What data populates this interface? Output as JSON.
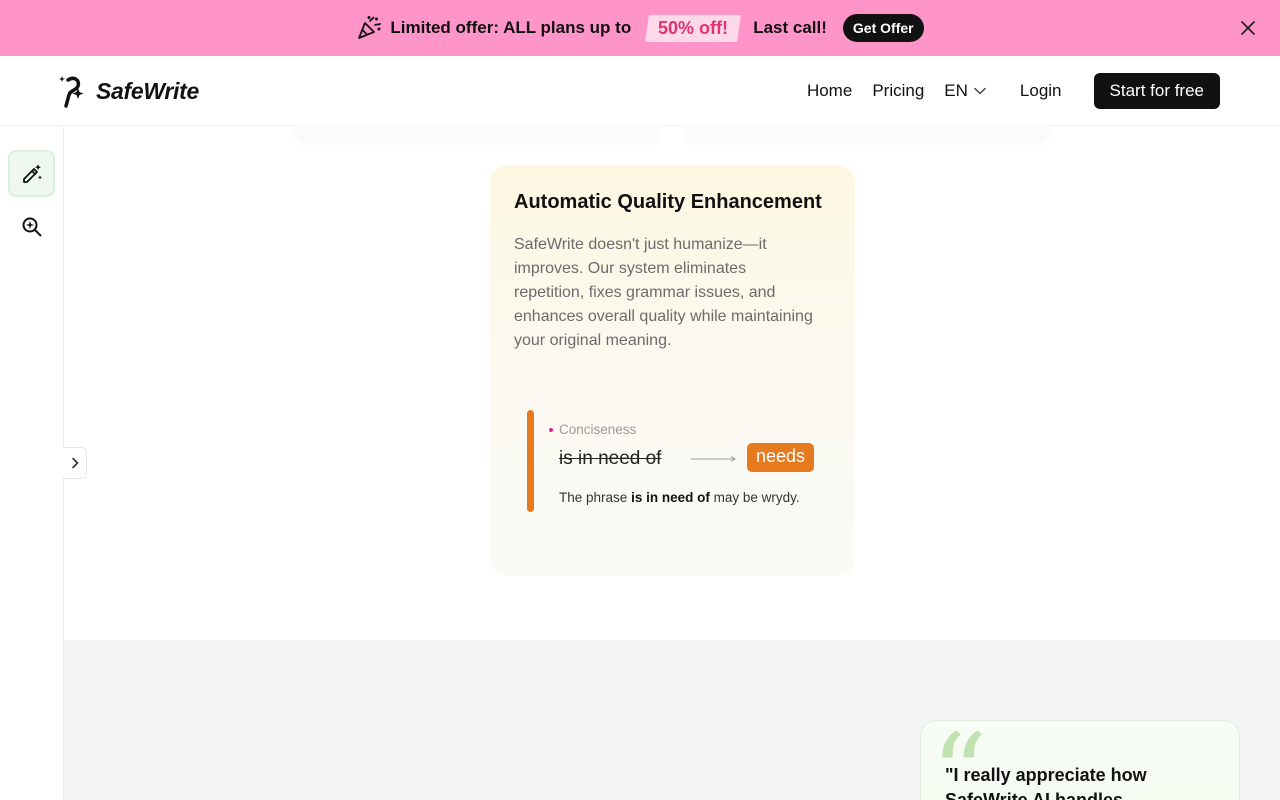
{
  "promo": {
    "icon": "party-popper-icon",
    "text": "Limited offer: ALL plans up to",
    "badge": "50% off!",
    "call": "Last call!",
    "button": "Get Offer",
    "close_icon": "close-icon"
  },
  "header": {
    "logo_text": "SafeWrite",
    "nav": {
      "home": "Home",
      "pricing": "Pricing",
      "lang": "EN",
      "login": "Login",
      "cta": "Start for free"
    }
  },
  "sidebar": {
    "items": [
      {
        "icon": "magic-pen-icon",
        "active": true
      },
      {
        "icon": "sparkle-search-icon",
        "active": false
      }
    ],
    "collapse_icon": "chevron-right-icon"
  },
  "feature_card": {
    "title": "Automatic Quality Enhancement",
    "description": "SafeWrite doesn't just humanize—it improves. Our system eliminates repetition, fixes grammar issues, and enhances overall quality while maintaining your original meaning.",
    "demo": {
      "category": "Conciseness",
      "original": "is in need of",
      "replacement": "needs",
      "explanation_prefix": "The phrase",
      "explanation_phrase": "is in need of",
      "explanation_suffix": "may be wrydy."
    }
  },
  "testimonial": {
    "quote_mark": "“",
    "text": "\"I really appreciate how SafeWrite AI handles"
  },
  "colors": {
    "banner": "#ff94c8",
    "accent_orange": "#e57a1e",
    "sidebar_active": "#eef8ee",
    "testimonial_quote": "#bfe2b0"
  }
}
